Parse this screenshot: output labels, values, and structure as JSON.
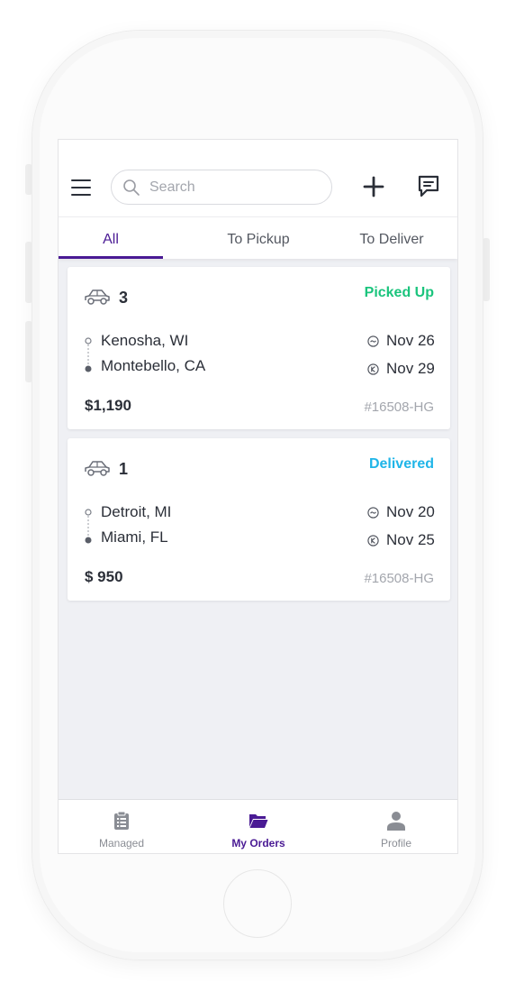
{
  "header": {
    "search_placeholder": "Search",
    "icons": [
      "menu-icon",
      "search-icon",
      "plus-icon",
      "message-icon"
    ]
  },
  "tabs": [
    {
      "label": "All",
      "active": true
    },
    {
      "label": "To Pickup",
      "active": false
    },
    {
      "label": "To Deliver",
      "active": false
    }
  ],
  "orders": [
    {
      "vehicles": "3",
      "status": "Picked Up",
      "status_color": "#1bc47d",
      "from": "Kenosha, WI",
      "to": "Montebello, CA",
      "pickup_date": "Nov 26",
      "delivery_date": "Nov 29",
      "price": "$1,190",
      "order_id": "#16508-HG"
    },
    {
      "vehicles": "1",
      "status": "Delivered",
      "status_color": "#1fb5e8",
      "from": "Detroit, MI",
      "to": "Miami, FL",
      "pickup_date": "Nov 20",
      "delivery_date": "Nov 25",
      "price": "$ 950",
      "order_id": "#16508-HG"
    }
  ],
  "bottom_nav": [
    {
      "label": "Managed",
      "icon": "clipboard-icon",
      "active": false
    },
    {
      "label": "My Orders",
      "icon": "folder-icon",
      "active": true
    },
    {
      "label": "Profile",
      "icon": "user-icon",
      "active": false
    }
  ],
  "colors": {
    "accent": "#4a1a94",
    "background": "#eff0f4",
    "text": "#2b2f38",
    "muted": "#a3a6ad"
  }
}
